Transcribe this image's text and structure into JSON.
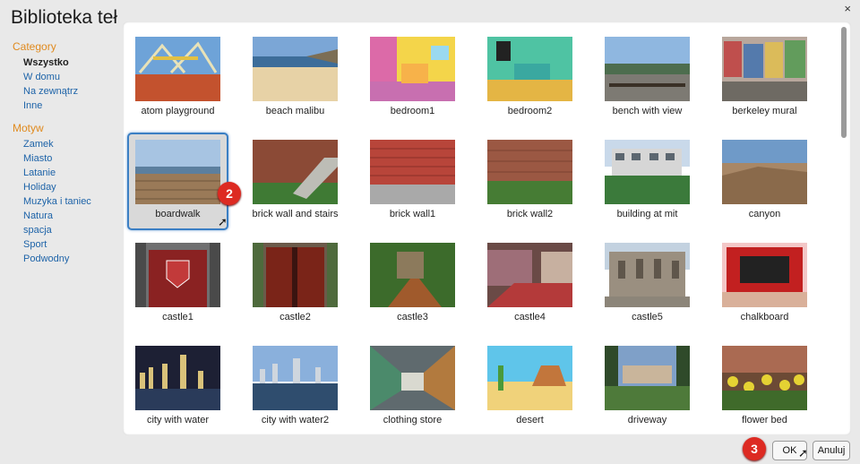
{
  "dialog": {
    "title": "Biblioteka teł",
    "close_icon": "×"
  },
  "sidebar": {
    "category": {
      "heading": "Category",
      "items": [
        "Wszystko",
        "W domu",
        "Na zewnątrz",
        "Inne"
      ],
      "selected": "Wszystko"
    },
    "theme": {
      "heading": "Motyw",
      "items": [
        "Zamek",
        "Miasto",
        "Latanie",
        "Holiday",
        "Muzyka i taniec",
        "Natura",
        "spacja",
        "Sport",
        "Podwodny"
      ]
    }
  },
  "backdrops": [
    [
      "atom playground",
      "beach malibu",
      "bedroom1",
      "bedroom2",
      "bench with view",
      "berkeley mural"
    ],
    [
      "boardwalk",
      "brick wall and stairs",
      "brick wall1",
      "brick wall2",
      "building at mit",
      "canyon"
    ],
    [
      "castle1",
      "castle2",
      "castle3",
      "castle4",
      "castle5",
      "chalkboard"
    ],
    [
      "city with water",
      "city with water2",
      "clothing store",
      "desert",
      "driveway",
      "flower bed"
    ]
  ],
  "selected_backdrop": "boardwalk",
  "buttons": {
    "ok": "OK",
    "cancel": "Anuluj"
  },
  "step_badges": {
    "select_step": "2",
    "confirm_step": "3"
  },
  "colors": {
    "accent": "#e08a1e",
    "link": "#1d63a8",
    "selection": "#3b7fc4",
    "badge": "#dd2a22"
  }
}
